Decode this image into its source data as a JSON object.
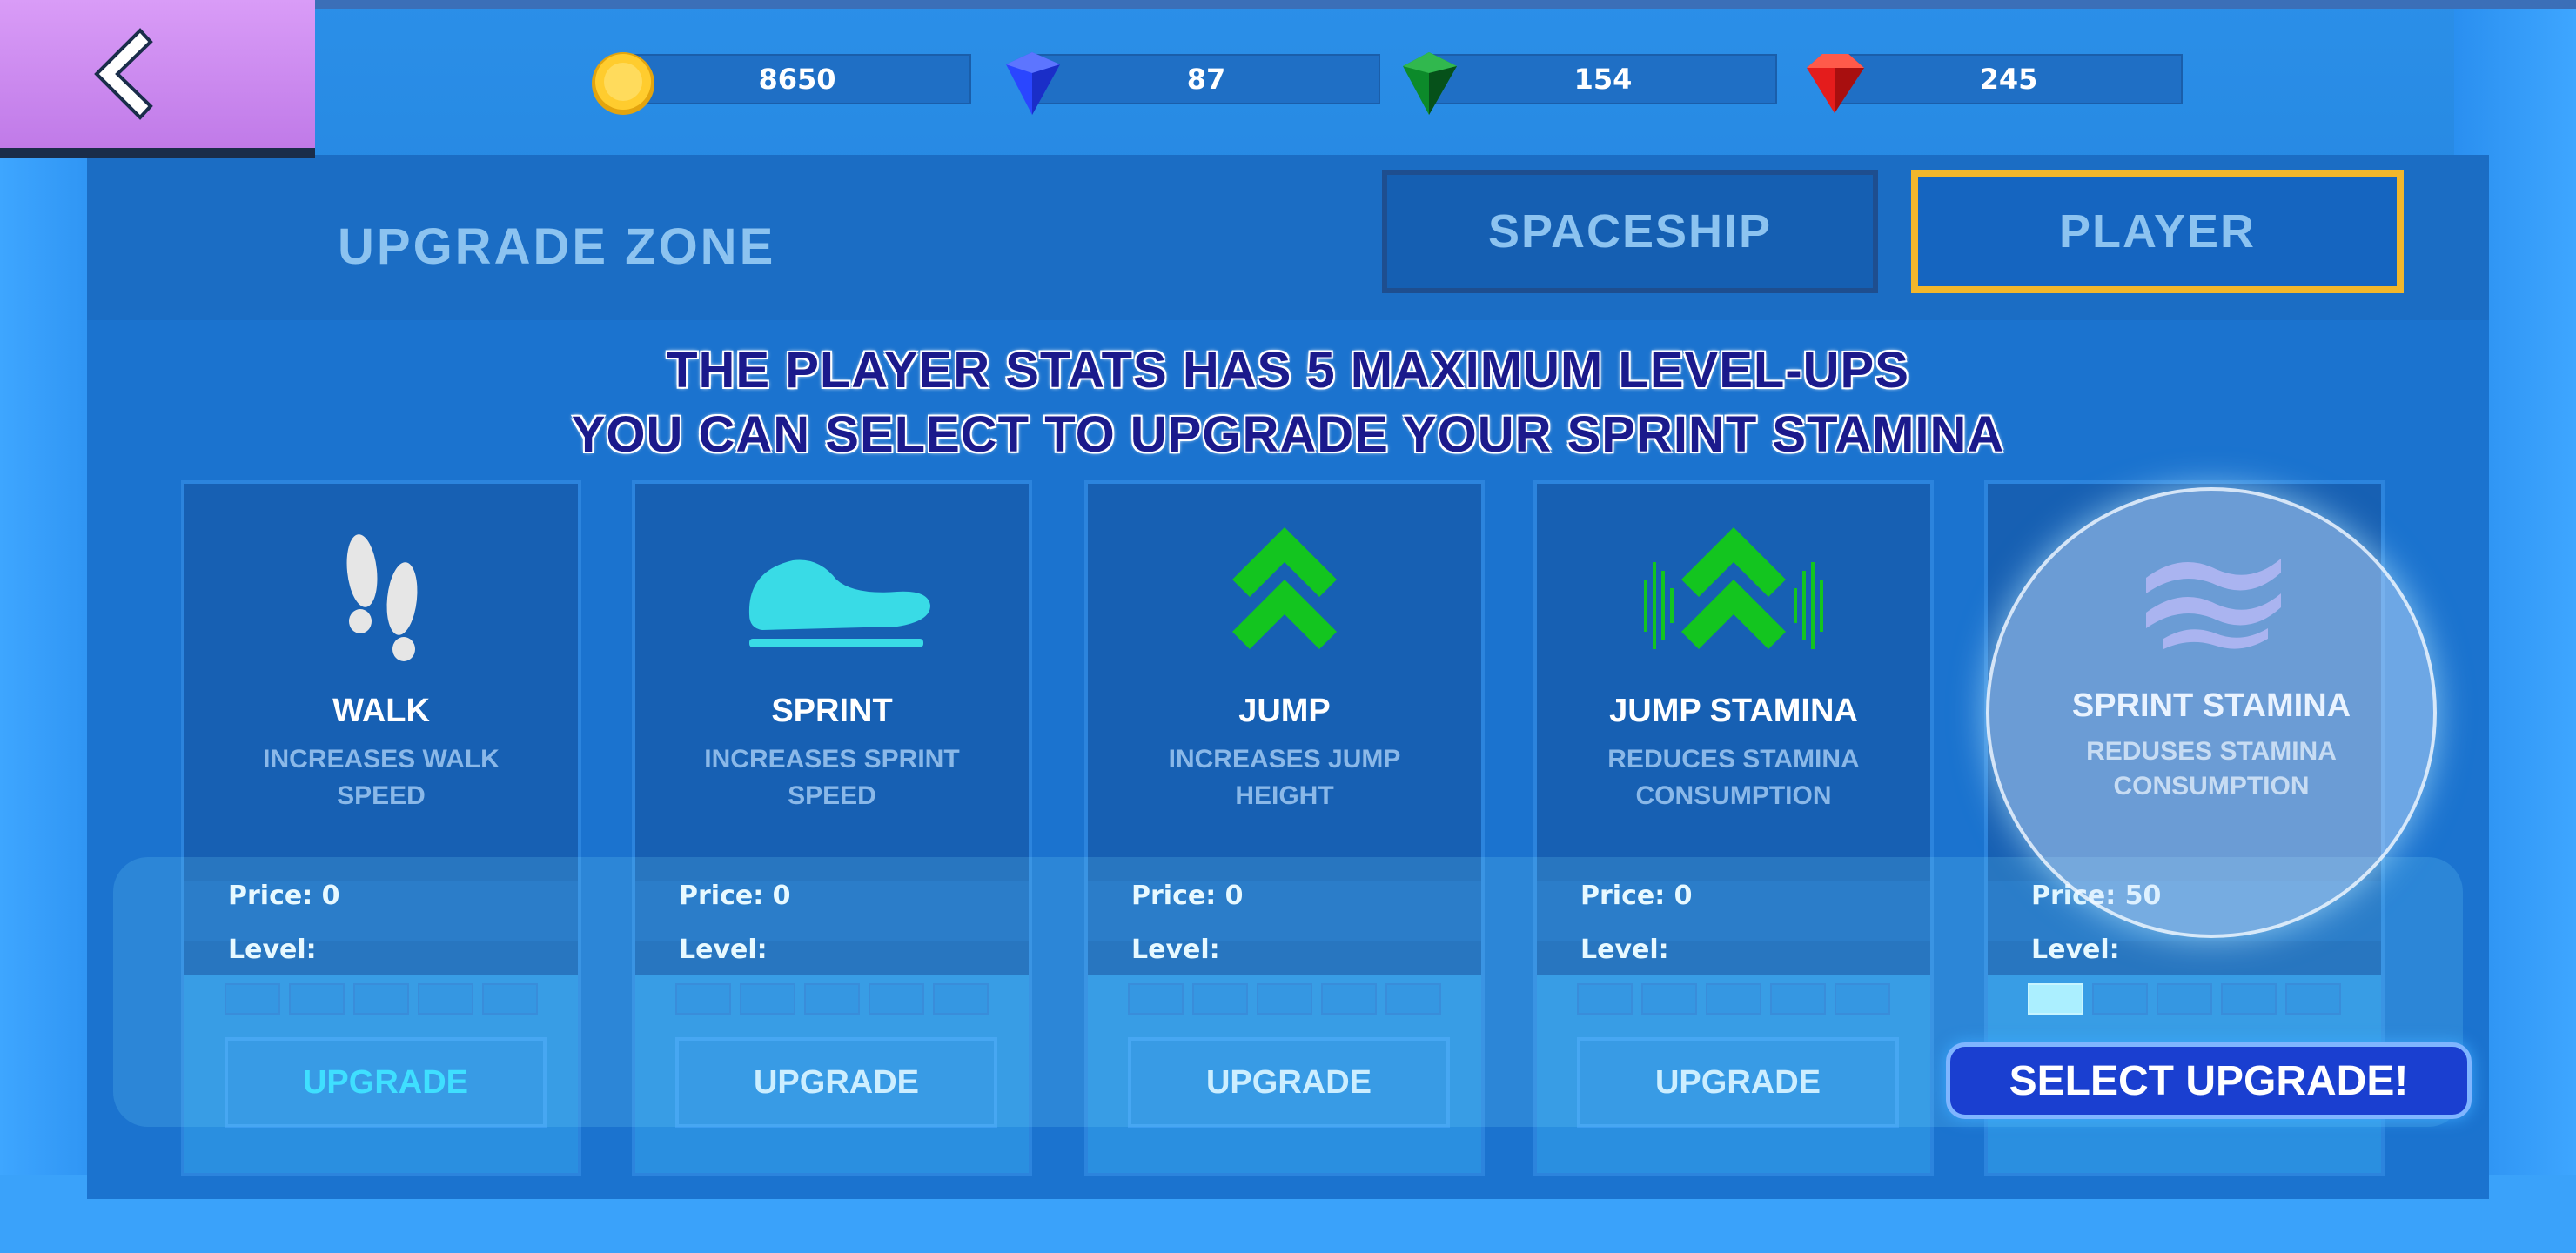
{
  "currencies": [
    {
      "icon": "gold-coin-icon",
      "value": "8650"
    },
    {
      "icon": "blue-gem-icon",
      "value": "87"
    },
    {
      "icon": "green-gem-icon",
      "value": "154"
    },
    {
      "icon": "red-gem-icon",
      "value": "245"
    }
  ],
  "header": {
    "title": "UPGRADE ZONE",
    "tabs": [
      {
        "label": "SPACESHIP",
        "selected": false
      },
      {
        "label": "PLAYER",
        "selected": true
      }
    ]
  },
  "headline": {
    "line1": "THE PLAYER STATS HAS 5 MAXIMUM LEVEL-UPS",
    "line2": "YOU CAN SELECT TO UPGRADE YOUR SPRINT STAMINA"
  },
  "cards": [
    {
      "name": "WALK",
      "desc1": "INCREASES WALK",
      "desc2": "SPEED",
      "price": "Price: 0",
      "level_label": "Level:",
      "level": 0,
      "max_level": 5,
      "button": "UPGRADE",
      "icon": "footsteps-icon"
    },
    {
      "name": "SPRINT",
      "desc1": "INCREASES SPRINT",
      "desc2": "SPEED",
      "price": "Price: 0",
      "level_label": "Level:",
      "level": 0,
      "max_level": 5,
      "button": "UPGRADE",
      "icon": "shoe-icon"
    },
    {
      "name": "JUMP",
      "desc1": "INCREASES JUMP",
      "desc2": "HEIGHT",
      "price": "Price: 0",
      "level_label": "Level:",
      "level": 0,
      "max_level": 5,
      "button": "UPGRADE",
      "icon": "double-chevron-up-icon"
    },
    {
      "name": "JUMP STAMINA",
      "desc1": "REDUCES STAMINA",
      "desc2": "CONSUMPTION",
      "price": "Price: 0",
      "level_label": "Level:",
      "level": 0,
      "max_level": 5,
      "button": "UPGRADE",
      "icon": "stamina-chevron-icon"
    },
    {
      "name": "SPRINT STAMINA",
      "desc1": "REDUSES STAMINA",
      "desc2": "CONSUMPTION",
      "price": "Price: 50",
      "level_label": "Level:",
      "level": 1,
      "max_level": 5,
      "button": "",
      "icon": "wind-waves-icon"
    }
  ],
  "callout": {
    "label": "SELECT UPGRADE!"
  },
  "colors": {
    "accent": "#f2b72b",
    "panel": "#1b73cf",
    "headline": "#1b1a8c",
    "level_filled": "#b6f3ff"
  }
}
